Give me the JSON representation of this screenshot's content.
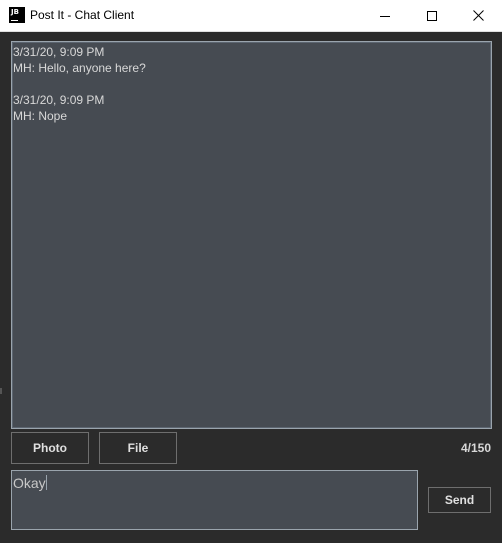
{
  "window": {
    "title": "Post It - Chat Client",
    "app_icon_text": "JB"
  },
  "controls": {
    "minimize": "minimize-icon",
    "maximize": "maximize-icon",
    "close": "close-icon"
  },
  "chat": {
    "messages": [
      {
        "timestamp": "3/31/20, 9:09 PM",
        "text": "MH: Hello, anyone here?"
      },
      {
        "timestamp": "3/31/20, 9:09 PM",
        "text": "MH: Nope"
      }
    ]
  },
  "toolbar": {
    "photo_label": "Photo",
    "file_label": "File",
    "char_count": "4/150"
  },
  "composer": {
    "input_value": "Okay",
    "send_label": "Send"
  },
  "colors": {
    "background": "#2b2b2b",
    "panel": "#464b52",
    "border": "#9aa4ad",
    "text": "#d8d8d8"
  }
}
